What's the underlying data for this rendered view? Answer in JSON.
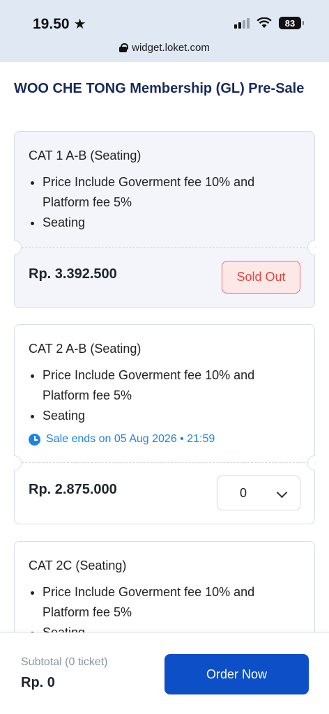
{
  "status_bar": {
    "time": "19.50",
    "battery": "83"
  },
  "browser": {
    "url": "widget.loket.com"
  },
  "page": {
    "title": "WOO CHE TONG Membership (GL) Pre-Sale"
  },
  "tickets": [
    {
      "name": "CAT 1 A-B (Seating)",
      "features": [
        "Price Include Goverment fee 10% and Platform fee 5%",
        "Seating"
      ],
      "price": "Rp. 3.392.500",
      "status": "Sold Out"
    },
    {
      "name": "CAT 2 A-B (Seating)",
      "features": [
        "Price Include Goverment fee 10% and Platform fee 5%",
        "Seating"
      ],
      "sale_ends": "Sale ends on 05 Aug 2026 • 21:59",
      "price": "Rp. 2.875.000",
      "quantity": "0"
    },
    {
      "name": "CAT 2C (Seating)",
      "features": [
        "Price Include Goverment fee 10% and Platform fee 5%",
        "Seating"
      ]
    }
  ],
  "footer": {
    "subtotal_label": "Subtotal (0 ticket)",
    "subtotal_value": "Rp. 0",
    "order_button": "Order Now"
  },
  "colors": {
    "primary": "#0d4fc6",
    "title": "#162a5c",
    "sold_out_text": "#e0463f",
    "sale_ends": "#1d84e4"
  }
}
